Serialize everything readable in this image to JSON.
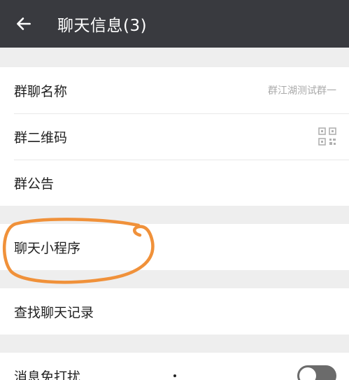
{
  "header": {
    "title": "聊天信息(3)"
  },
  "section1": {
    "group_name_label": "群聊名称",
    "group_name_value": "群江湖测试群一",
    "qr_label": "群二维码",
    "notice_label": "群公告"
  },
  "section2": {
    "mini_program_label": "聊天小程序"
  },
  "section3": {
    "search_history_label": "查找聊天记录"
  },
  "section4": {
    "mute_label": "消息免打扰",
    "mute_enabled": false
  },
  "colors": {
    "header_bg": "#393a3f",
    "annotation_circle": "#f0913a"
  },
  "icons": {
    "back": "arrow-left-icon",
    "qr": "qr-code-icon"
  }
}
